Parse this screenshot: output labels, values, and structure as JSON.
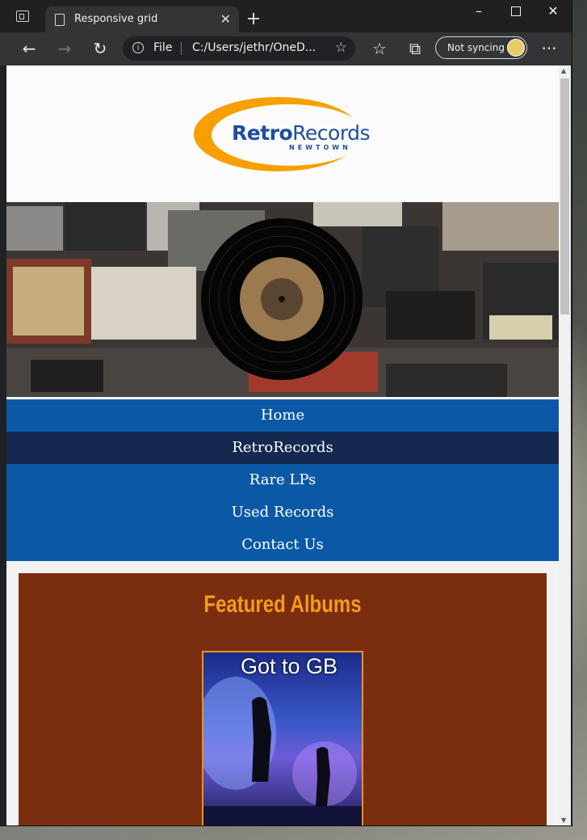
{
  "browser": {
    "tab_title": "Responsive grid",
    "address_scheme": "File",
    "address_url": "C:/Users/jethr/OneD...",
    "sync_label": "Not syncing"
  },
  "site": {
    "logo": {
      "word_bold": "Retro",
      "word_regular": "Records",
      "subtitle": "NEWTOWN"
    },
    "nav": {
      "items": [
        {
          "label": "Home",
          "active": false
        },
        {
          "label": "RetroRecords",
          "active": true
        },
        {
          "label": "Rare LPs",
          "active": false
        },
        {
          "label": "Used Records",
          "active": false
        },
        {
          "label": "Contact Us",
          "active": false
        }
      ]
    },
    "featured": {
      "title": "Featured Albums",
      "album_caption": "Got to GB"
    },
    "colors": {
      "nav_bg": "#0b59a6",
      "nav_active_bg": "#15284f",
      "featured_bg": "#7a2d0f",
      "featured_title": "#f49b1a",
      "logo_blue": "#1f4e9c",
      "logo_swoosh": "#f5a000"
    }
  }
}
